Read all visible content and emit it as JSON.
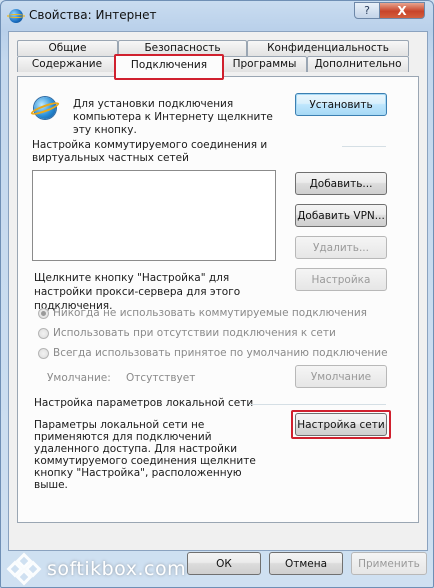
{
  "window": {
    "title": "Свойства: Интернет",
    "help_label": "?",
    "close_label": "X"
  },
  "tabs": {
    "row_back": [
      {
        "label": "Общие"
      },
      {
        "label": "Безопасность"
      },
      {
        "label": "Конфиденциальность"
      }
    ],
    "row_front": [
      {
        "label": "Содержание"
      },
      {
        "label": "Подключения",
        "selected": true
      },
      {
        "label": "Программы"
      },
      {
        "label": "Дополнительно"
      }
    ]
  },
  "connections": {
    "setup_text": "Для установки подключения компьютера к Интернету щелкните эту кнопку.",
    "setup_button": "Установить",
    "dialup_heading": "Настройка коммутируемого соединения и виртуальных частных сетей",
    "dialup_list_items": [],
    "add_button": "Добавить...",
    "add_vpn_button": "Добавить VPN...",
    "remove_button": "Удалить...",
    "settings_hint": "Щелкните кнопку \"Настройка\" для настройки прокси-сервера для этого подключения.",
    "settings_button": "Настройка",
    "radio_options": [
      {
        "label": "Никогда не использовать коммутируемые подключения",
        "checked": true
      },
      {
        "label": "Использовать при отсутствии подключения к сети",
        "checked": false
      },
      {
        "label": "Всегда использовать принятое по умолчанию подключение",
        "checked": false
      }
    ],
    "default_label": "Умолчание:",
    "default_value": "Отсутствует",
    "default_button": "Умолчание",
    "lan_heading": "Настройка параметров локальной сети",
    "lan_text": "Параметры локальной сети не применяются для подключений удаленного доступа. Для настройки коммутируемого соединения щелкните кнопку \"Настройка\", расположенную выше.",
    "lan_button": "Настройка сети"
  },
  "footer": {
    "ok": "ОК",
    "cancel": "Отмена",
    "apply": "Применить"
  },
  "watermark": {
    "text": "softikbox.com"
  },
  "colors": {
    "highlight_outline": "#d0202e",
    "window_frame": "#b9d0ea"
  }
}
